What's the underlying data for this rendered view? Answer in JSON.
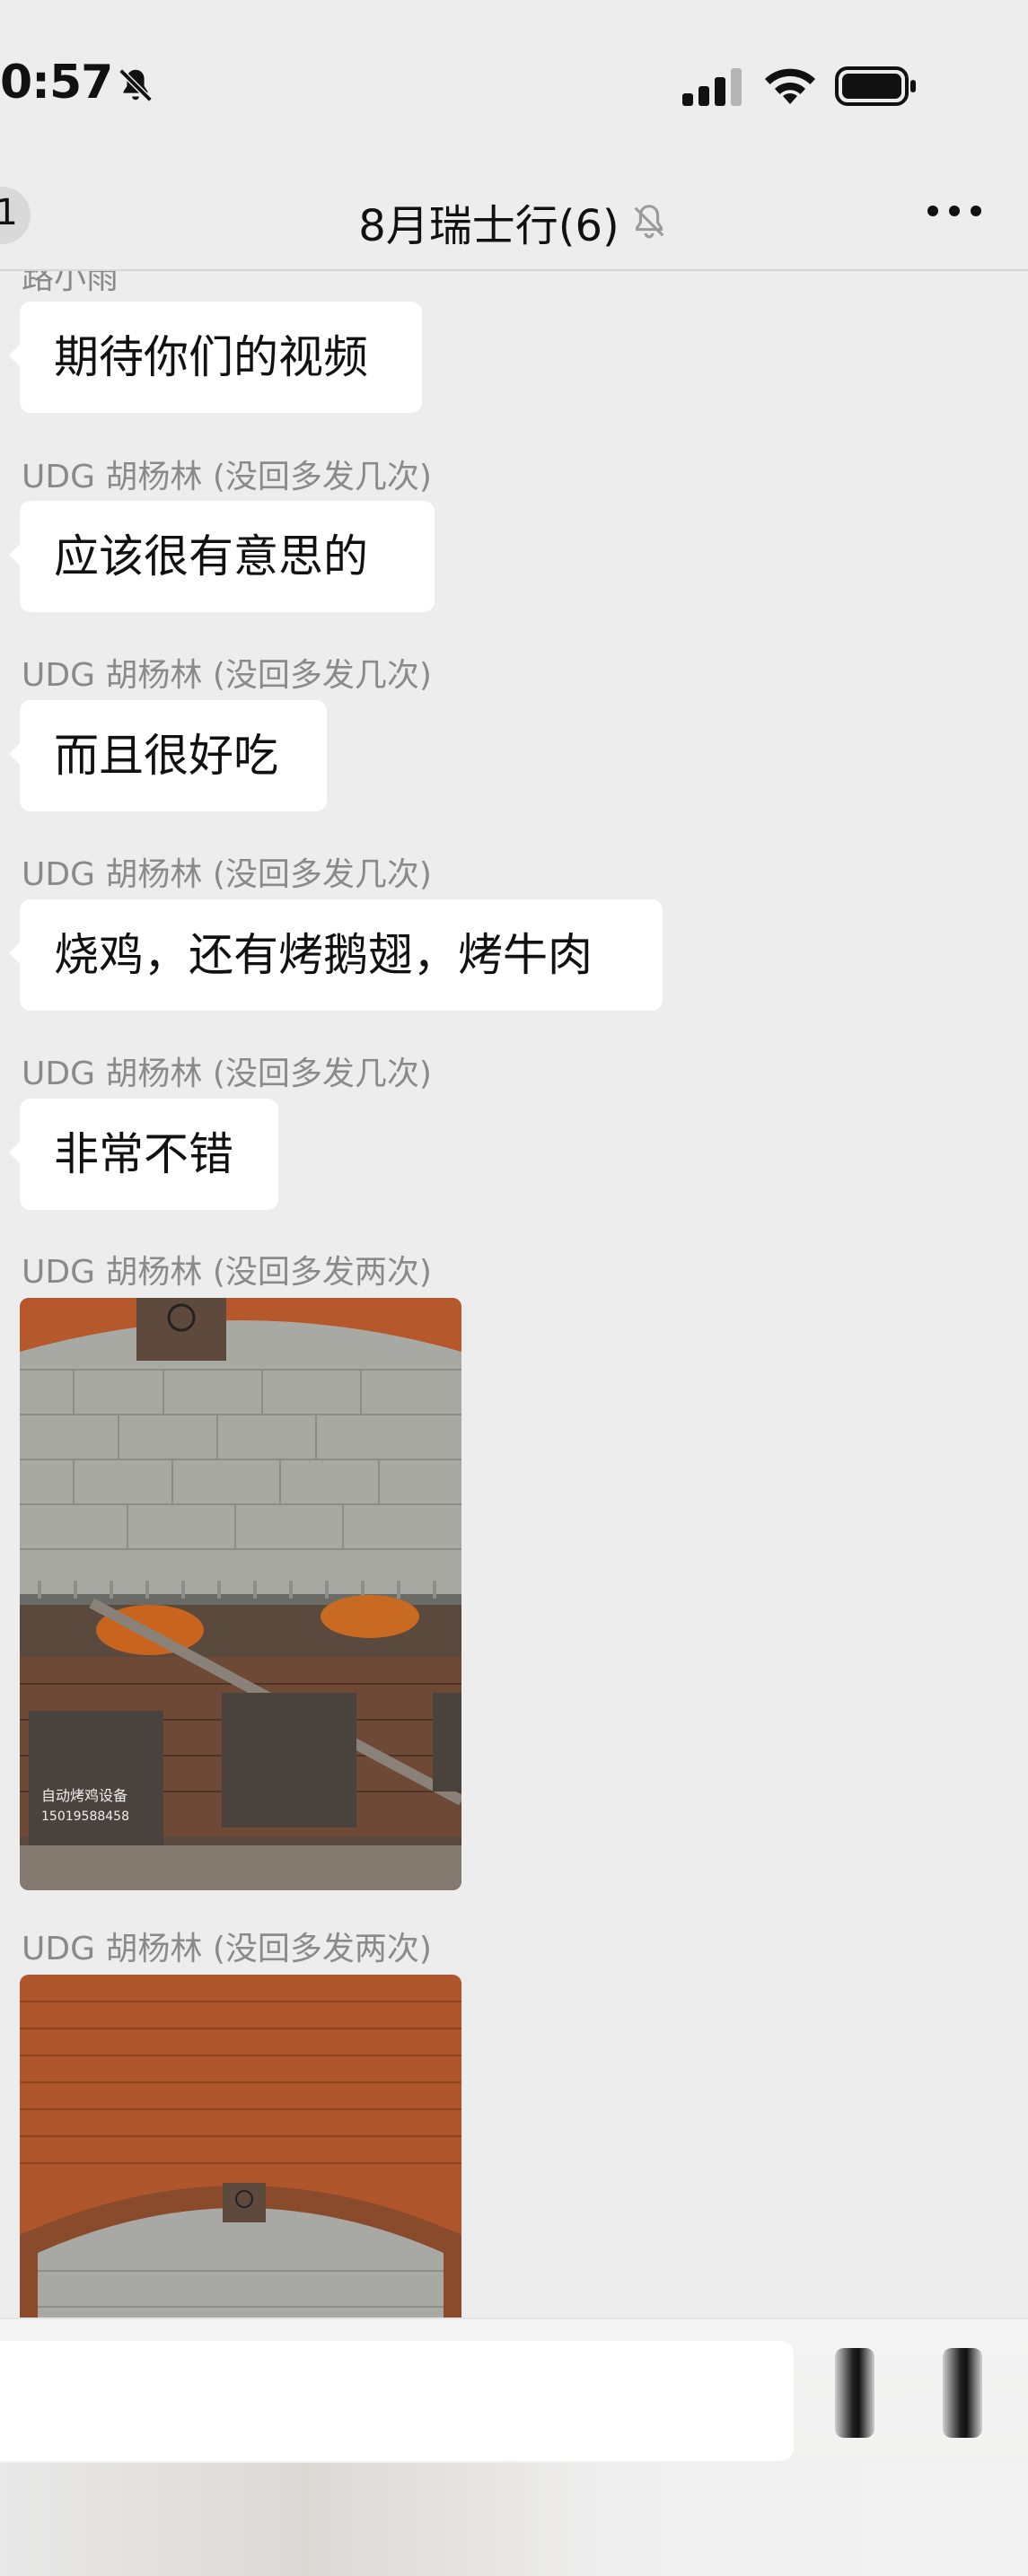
{
  "status_bar": {
    "time": "0:57"
  },
  "nav": {
    "back_badge": "1",
    "title": "8月瑞士行(6)",
    "icons": [
      "bell-off-icon",
      "more-icon"
    ]
  },
  "messages": [
    {
      "sender": "路小雨",
      "text": "期待你们的视频"
    },
    {
      "sender": "UDG 胡杨林 (没回多发几次)",
      "text": "应该很有意思的"
    },
    {
      "sender": "UDG 胡杨林 (没回多发几次)",
      "text": "而且很好吃"
    },
    {
      "sender": "UDG 胡杨林 (没回多发几次)",
      "text": "烧鸡，还有烤鹅翅，烤牛肉"
    },
    {
      "sender": "UDG 胡杨林 (没回多发几次)",
      "text": "非常不错"
    },
    {
      "sender": "UDG 胡杨林 (没回多发两次)",
      "image": "photo-rotisserie",
      "overlay_text": [
        "自动烤鸡设备",
        "15019588458"
      ]
    },
    {
      "sender": "UDG 胡杨林 (没回多发两次)",
      "image": "photo-brick-oven"
    }
  ],
  "input": {
    "value": ""
  },
  "colors": {
    "background": "#ededed",
    "bubble": "#ffffff",
    "sender": "#8a8a8a"
  }
}
